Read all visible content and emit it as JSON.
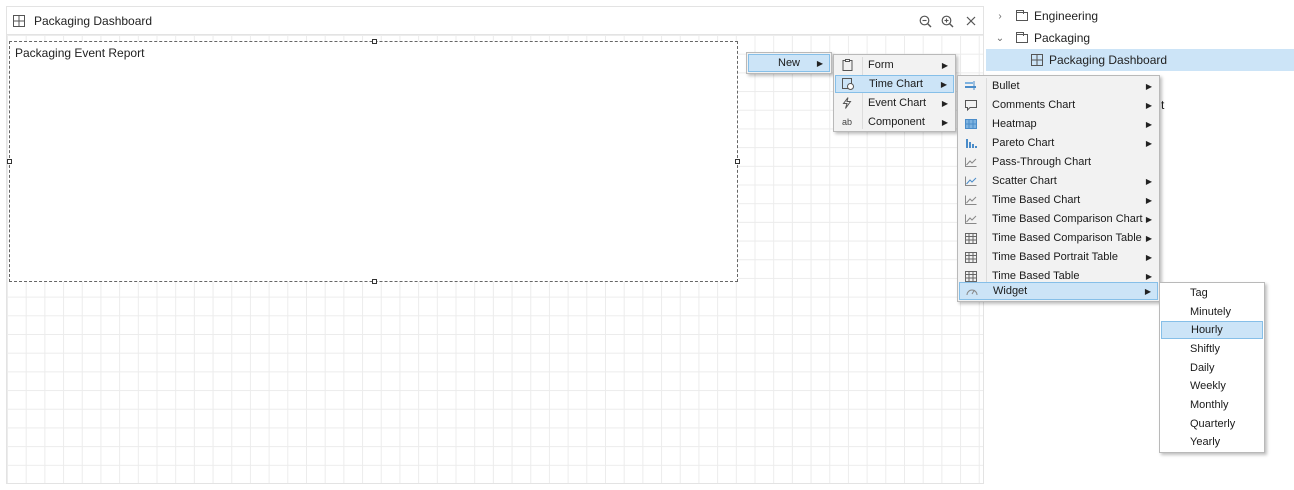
{
  "editor": {
    "title": "Packaging Dashboard",
    "zoom_out_icon": "zoom-out-icon",
    "zoom_in_icon": "zoom-in-icon",
    "close_icon": "close-icon",
    "report_label": "Packaging Event Report"
  },
  "tree": {
    "items": [
      {
        "label": "Engineering",
        "expanded": false
      },
      {
        "label": "Packaging",
        "expanded": true
      },
      {
        "label": "Packaging Dashboard",
        "selected": true
      }
    ],
    "partial_text": "t"
  },
  "menus": {
    "new": {
      "label": "New"
    },
    "level1": [
      {
        "label": "Form",
        "icon": "clipboard-icon"
      },
      {
        "label": "Time Chart",
        "icon": "time-chart-icon",
        "highlighted": true
      },
      {
        "label": "Event Chart",
        "icon": "lightning-icon"
      },
      {
        "label": "Component",
        "icon": "text-ab-icon",
        "icon_text": "ab"
      }
    ],
    "level2": [
      {
        "label": "Bullet",
        "icon": "bullet-chart-icon",
        "submenu": true
      },
      {
        "label": "Comments Chart",
        "icon": "comment-icon",
        "submenu": true
      },
      {
        "label": "Heatmap",
        "icon": "heatmap-icon",
        "submenu": true
      },
      {
        "label": "Pareto Chart",
        "icon": "pareto-icon",
        "submenu": true
      },
      {
        "label": "Pass-Through Chart",
        "icon": "line-chart-icon",
        "submenu": false
      },
      {
        "label": "Scatter Chart",
        "icon": "line-chart-icon",
        "submenu": true
      },
      {
        "label": "Time Based Chart",
        "icon": "line-chart-icon",
        "submenu": true
      },
      {
        "label": "Time Based Comparison Chart",
        "icon": "line-chart-icon",
        "submenu": true
      },
      {
        "label": "Time Based Comparison Table",
        "icon": "table-icon",
        "submenu": true
      },
      {
        "label": "Time Based Portrait Table",
        "icon": "table-icon",
        "submenu": true
      },
      {
        "label": "Time Based Table",
        "icon": "table-icon",
        "submenu": true
      },
      {
        "label": "Widget",
        "icon": "gauge-icon",
        "submenu": true,
        "highlighted": true
      }
    ],
    "level3": [
      {
        "label": "Tag"
      },
      {
        "label": "Minutely"
      },
      {
        "label": "Hourly",
        "highlighted": true
      },
      {
        "label": "Shiftly"
      },
      {
        "label": "Daily"
      },
      {
        "label": "Weekly"
      },
      {
        "label": "Monthly"
      },
      {
        "label": "Quarterly"
      },
      {
        "label": "Yearly"
      }
    ]
  },
  "colors": {
    "highlight": "#cce4f7",
    "highlight_border": "#86bfe8",
    "menu_bg": "#f2f2f2",
    "icon_blue": "#4a8cc9"
  }
}
